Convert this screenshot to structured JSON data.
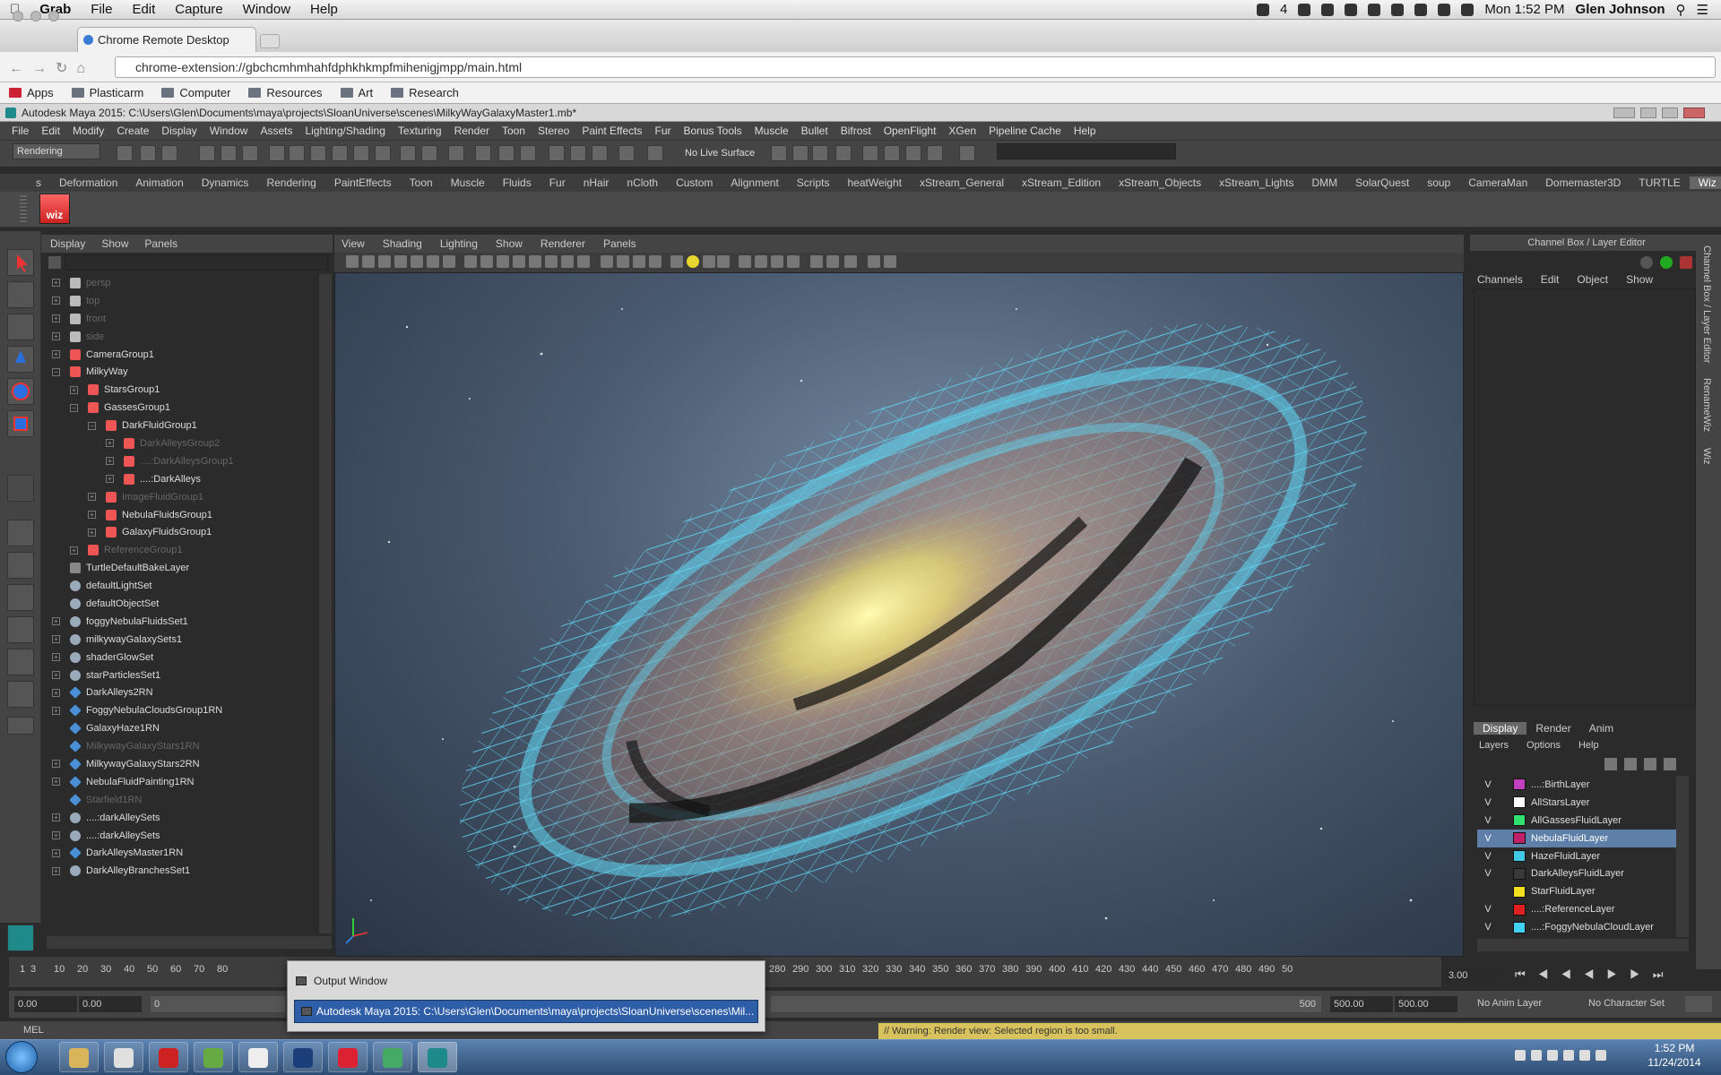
{
  "mac_menu": {
    "apple": "",
    "app": "Grab",
    "items": [
      "File",
      "Edit",
      "Capture",
      "Window",
      "Help"
    ],
    "status_count": "4",
    "clock": "Mon 1:52 PM",
    "user": "Glen Johnson"
  },
  "chrome": {
    "tab_title": "Chrome Remote Desktop",
    "url": "chrome-extension://gbchcmhmhahfdphkhkmpfmihenigjmpp/main.html",
    "bookmarks": [
      "Apps",
      "Plasticarm",
      "Computer",
      "Resources",
      "Art",
      "Research"
    ]
  },
  "maya": {
    "title": "Autodesk Maya 2015: C:\\Users\\Glen\\Documents\\maya\\projects\\SloanUniverse\\scenes\\MilkyWayGalaxyMaster1.mb*",
    "menu": [
      "File",
      "Edit",
      "Modify",
      "Create",
      "Display",
      "Window",
      "Assets",
      "Lighting/Shading",
      "Texturing",
      "Render",
      "Toon",
      "Stereo",
      "Paint Effects",
      "Fur",
      "Bonus Tools",
      "Muscle",
      "Bullet",
      "Bifrost",
      "OpenFlight",
      "XGen",
      "Pipeline Cache",
      "Help"
    ],
    "mode": "Rendering",
    "no_live_surface": "No Live Surface",
    "shelf_tabs": [
      "s",
      "Deformation",
      "Animation",
      "Dynamics",
      "Rendering",
      "PaintEffects",
      "Toon",
      "Muscle",
      "Fluids",
      "Fur",
      "nHair",
      "nCloth",
      "Custom",
      "Alignment",
      "Scripts",
      "heatWeight",
      "xStream_General",
      "xStream_Edition",
      "xStream_Objects",
      "xStream_Lights",
      "DMM",
      "SolarQuest",
      "soup",
      "CameraMan",
      "Domemaster3D",
      "TURTLE",
      "Wiz"
    ],
    "shelf_active": "Wiz",
    "wiz_label": "wiz",
    "outliner_menu": [
      "Display",
      "Show",
      "Panels"
    ],
    "outliner": [
      {
        "label": "persp",
        "depth": 0,
        "plus": true,
        "dim": true,
        "icon": "camera"
      },
      {
        "label": "top",
        "depth": 0,
        "plus": true,
        "dim": true,
        "icon": "camera"
      },
      {
        "label": "front",
        "depth": 0,
        "plus": true,
        "dim": true,
        "icon": "camera"
      },
      {
        "label": "side",
        "depth": 0,
        "plus": true,
        "dim": true,
        "icon": "camera"
      },
      {
        "label": "CameraGroup1",
        "depth": 0,
        "plus": true,
        "icon": "group"
      },
      {
        "label": "MilkyWay",
        "depth": 0,
        "plus": true,
        "icon": "group",
        "open": true
      },
      {
        "label": "StarsGroup1",
        "depth": 1,
        "plus": true,
        "icon": "group"
      },
      {
        "label": "GassesGroup1",
        "depth": 1,
        "plus": true,
        "icon": "group",
        "open": true
      },
      {
        "label": "DarkFluidGroup1",
        "depth": 2,
        "plus": true,
        "icon": "group",
        "open": true
      },
      {
        "label": "DarkAlleysGroup2",
        "depth": 3,
        "plus": true,
        "dim": true,
        "icon": "group"
      },
      {
        "label": "....:DarkAlleysGroup1",
        "depth": 3,
        "plus": true,
        "dim": true,
        "icon": "group"
      },
      {
        "label": "....:DarkAlleys",
        "depth": 3,
        "plus": true,
        "icon": "group"
      },
      {
        "label": "ImageFluidGroup1",
        "depth": 2,
        "plus": true,
        "dim": true,
        "icon": "group"
      },
      {
        "label": "NebulaFluidsGroup1",
        "depth": 2,
        "plus": true,
        "icon": "group"
      },
      {
        "label": "GalaxyFluidsGroup1",
        "depth": 2,
        "plus": true,
        "icon": "group"
      },
      {
        "label": "ReferenceGroup1",
        "depth": 1,
        "plus": true,
        "dim": true,
        "icon": "group"
      },
      {
        "label": "TurtleDefaultBakeLayer",
        "depth": 0,
        "plus": false,
        "icon": "node"
      },
      {
        "label": "defaultLightSet",
        "depth": 0,
        "plus": false,
        "icon": "set"
      },
      {
        "label": "defaultObjectSet",
        "depth": 0,
        "plus": false,
        "icon": "set"
      },
      {
        "label": "foggyNebulaFluidsSet1",
        "depth": 0,
        "plus": true,
        "icon": "set"
      },
      {
        "label": "milkywayGalaxySets1",
        "depth": 0,
        "plus": true,
        "icon": "set"
      },
      {
        "label": "shaderGlowSet",
        "depth": 0,
        "plus": true,
        "icon": "set"
      },
      {
        "label": "starParticlesSet1",
        "depth": 0,
        "plus": true,
        "icon": "set"
      },
      {
        "label": "DarkAlleys2RN",
        "depth": 0,
        "plus": true,
        "icon": "ref"
      },
      {
        "label": "FoggyNebulaCloudsGroup1RN",
        "depth": 0,
        "plus": true,
        "icon": "ref"
      },
      {
        "label": "GalaxyHaze1RN",
        "depth": 0,
        "plus": false,
        "icon": "ref"
      },
      {
        "label": "MilkywayGalaxyStars1RN",
        "depth": 0,
        "plus": false,
        "dim": true,
        "icon": "ref"
      },
      {
        "label": "MilkywayGalaxyStars2RN",
        "depth": 0,
        "plus": true,
        "icon": "ref"
      },
      {
        "label": "NebulaFluidPainting1RN",
        "depth": 0,
        "plus": true,
        "icon": "ref"
      },
      {
        "label": "Starfield1RN",
        "depth": 0,
        "plus": false,
        "dim": true,
        "icon": "ref"
      },
      {
        "label": "....:darkAlleySets",
        "depth": 0,
        "plus": true,
        "icon": "set"
      },
      {
        "label": "....:darkAlleySets",
        "depth": 0,
        "plus": true,
        "icon": "set"
      },
      {
        "label": "DarkAlleysMaster1RN",
        "depth": 0,
        "plus": true,
        "icon": "ref"
      },
      {
        "label": "DarkAlleyBranchesSet1",
        "depth": 0,
        "plus": true,
        "icon": "set"
      }
    ],
    "viewport_menu": [
      "View",
      "Shading",
      "Lighting",
      "Show",
      "Renderer",
      "Panels"
    ],
    "channel_box_title": "Channel Box / Layer Editor",
    "channel_menu": [
      "Channels",
      "Edit",
      "Object",
      "Show"
    ],
    "side_tabs": [
      "Channel Box / Layer Editor",
      "RenameWiz",
      "Wiz"
    ],
    "layer_tabs": [
      "Display",
      "Render",
      "Anim"
    ],
    "layer_tab_active": "Display",
    "layer_menu": [
      "Layers",
      "Options",
      "Help"
    ],
    "layers": [
      {
        "v": "V",
        "name": "....:BirthLayer",
        "color": "#c040c0"
      },
      {
        "v": "V",
        "name": "AllStarsLayer",
        "color": "#ffffff"
      },
      {
        "v": "V",
        "name": "AllGassesFluidLayer",
        "color": "#30e070"
      },
      {
        "v": "V",
        "name": "NebulaFluidLayer",
        "color": "#c0206a",
        "selected": true
      },
      {
        "v": "V",
        "name": "HazeFluidLayer",
        "color": "#40c8e8"
      },
      {
        "v": "V",
        "name": "DarkAlleysFluidLayer",
        "color": "#3a3a3a"
      },
      {
        "v": "",
        "name": "StarFluidLayer",
        "color": "#f0e020"
      },
      {
        "v": "V",
        "name": "....:ReferenceLayer",
        "color": "#e02020"
      },
      {
        "v": "V",
        "name": "....:FoggyNebulaCloudLayer",
        "color": "#40d0f0"
      }
    ],
    "timeline_ticks": [
      "1",
      "3",
      "10",
      "20",
      "30",
      "40",
      "50",
      "60",
      "70",
      "80",
      "280",
      "290",
      "300",
      "310",
      "320",
      "330",
      "340",
      "350",
      "360",
      "370",
      "380",
      "390",
      "400",
      "410",
      "420",
      "430",
      "440",
      "450",
      "460",
      "470",
      "480",
      "490",
      "50"
    ],
    "current_frame": "3.00",
    "range": {
      "start": "0.00",
      "start2": "0.00",
      "inner_start": "0",
      "inner_end": "500",
      "end": "500.00",
      "end2": "500.00"
    },
    "anim_layer": "No Anim Layer",
    "character_set": "No Character Set",
    "mel_label": "MEL",
    "warning": "// Warning: Render view: Selected region is too small."
  },
  "output_popup": {
    "item1": "Output Window",
    "item2": "Autodesk Maya 2015: C:\\Users\\Glen\\Documents\\maya\\projects\\SloanUniverse\\scenes\\Mil..."
  },
  "taskbar": {
    "time": "1:52 PM",
    "date": "11/24/2014",
    "apps": [
      "explorer",
      "chrome",
      "filezilla",
      "notepad",
      "apps",
      "photoshop",
      "acrobat",
      "remote",
      "maya"
    ]
  }
}
